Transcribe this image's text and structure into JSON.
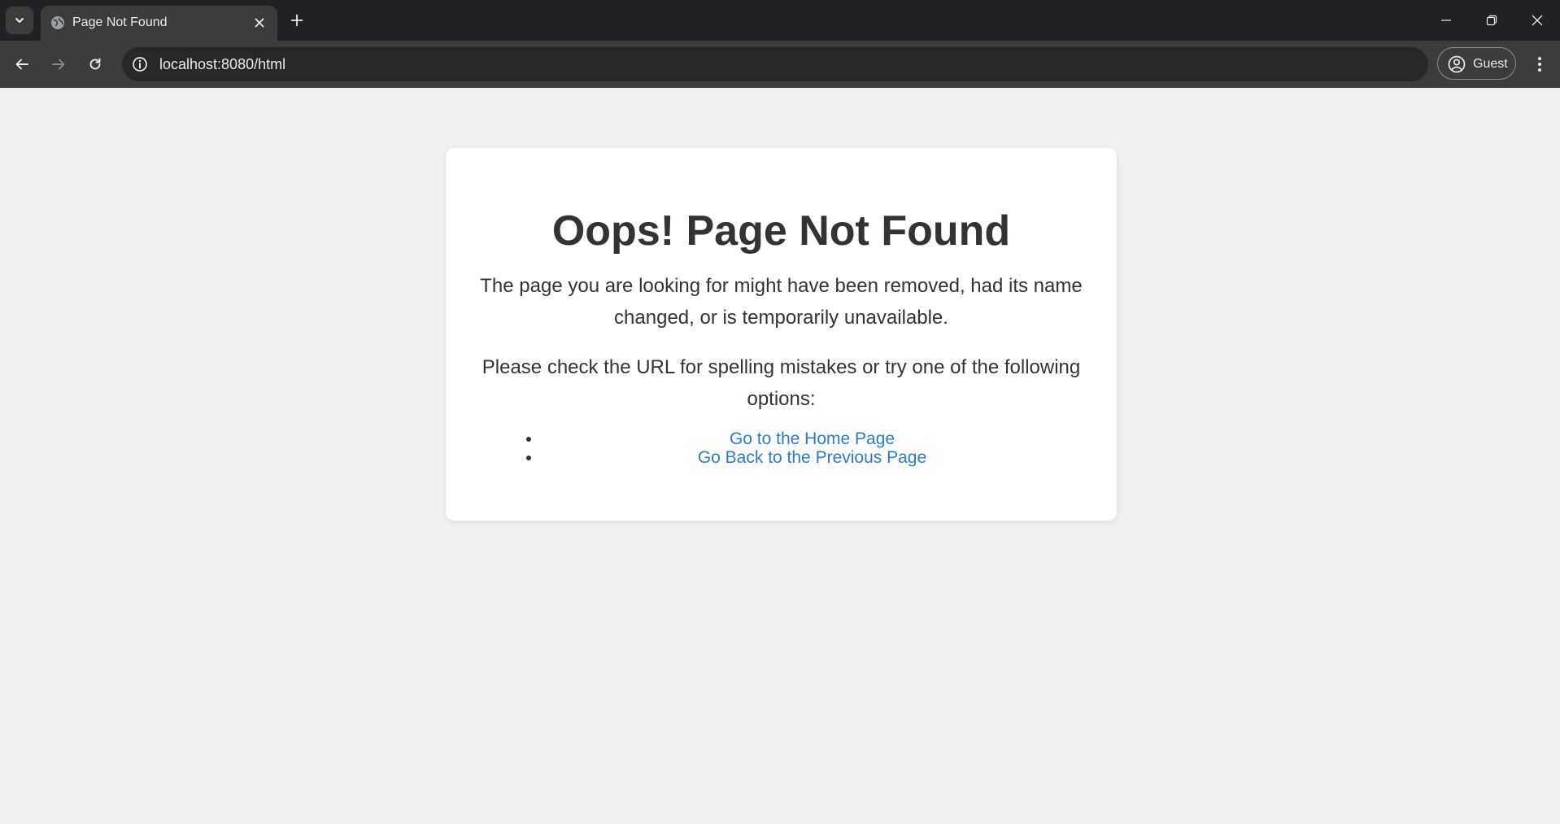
{
  "browser": {
    "tab_title": "Page Not Found",
    "url": "localhost:8080/html",
    "profile_label": "Guest",
    "icons": {
      "tab_search": "chevron-down-icon",
      "favicon": "globe-icon",
      "tab_close": "close-icon",
      "new_tab": "plus-icon",
      "minimize": "minimize-icon",
      "restore": "restore-icon",
      "close_window": "close-icon",
      "back": "arrow-left-icon",
      "forward": "arrow-right-icon",
      "reload": "reload-icon",
      "site_info": "info-icon",
      "profile": "person-circle-icon",
      "menu": "kebab-menu-icon"
    }
  },
  "page": {
    "heading": "Oops! Page Not Found",
    "message": "The page you are looking for might have been removed, had its name changed, or is temporarily unavailable.",
    "suggestion": "Please check the URL for spelling mistakes or try one of the following options:",
    "links": [
      {
        "label": "Go to the Home Page"
      },
      {
        "label": "Go Back to the Previous Page"
      }
    ]
  },
  "colors": {
    "page_background": "#f0f0f0",
    "card_background": "#ffffff",
    "text": "#333333",
    "link": "#2a7ad2",
    "chrome_dark": "#202124",
    "chrome_toolbar": "#3c3c3c"
  }
}
